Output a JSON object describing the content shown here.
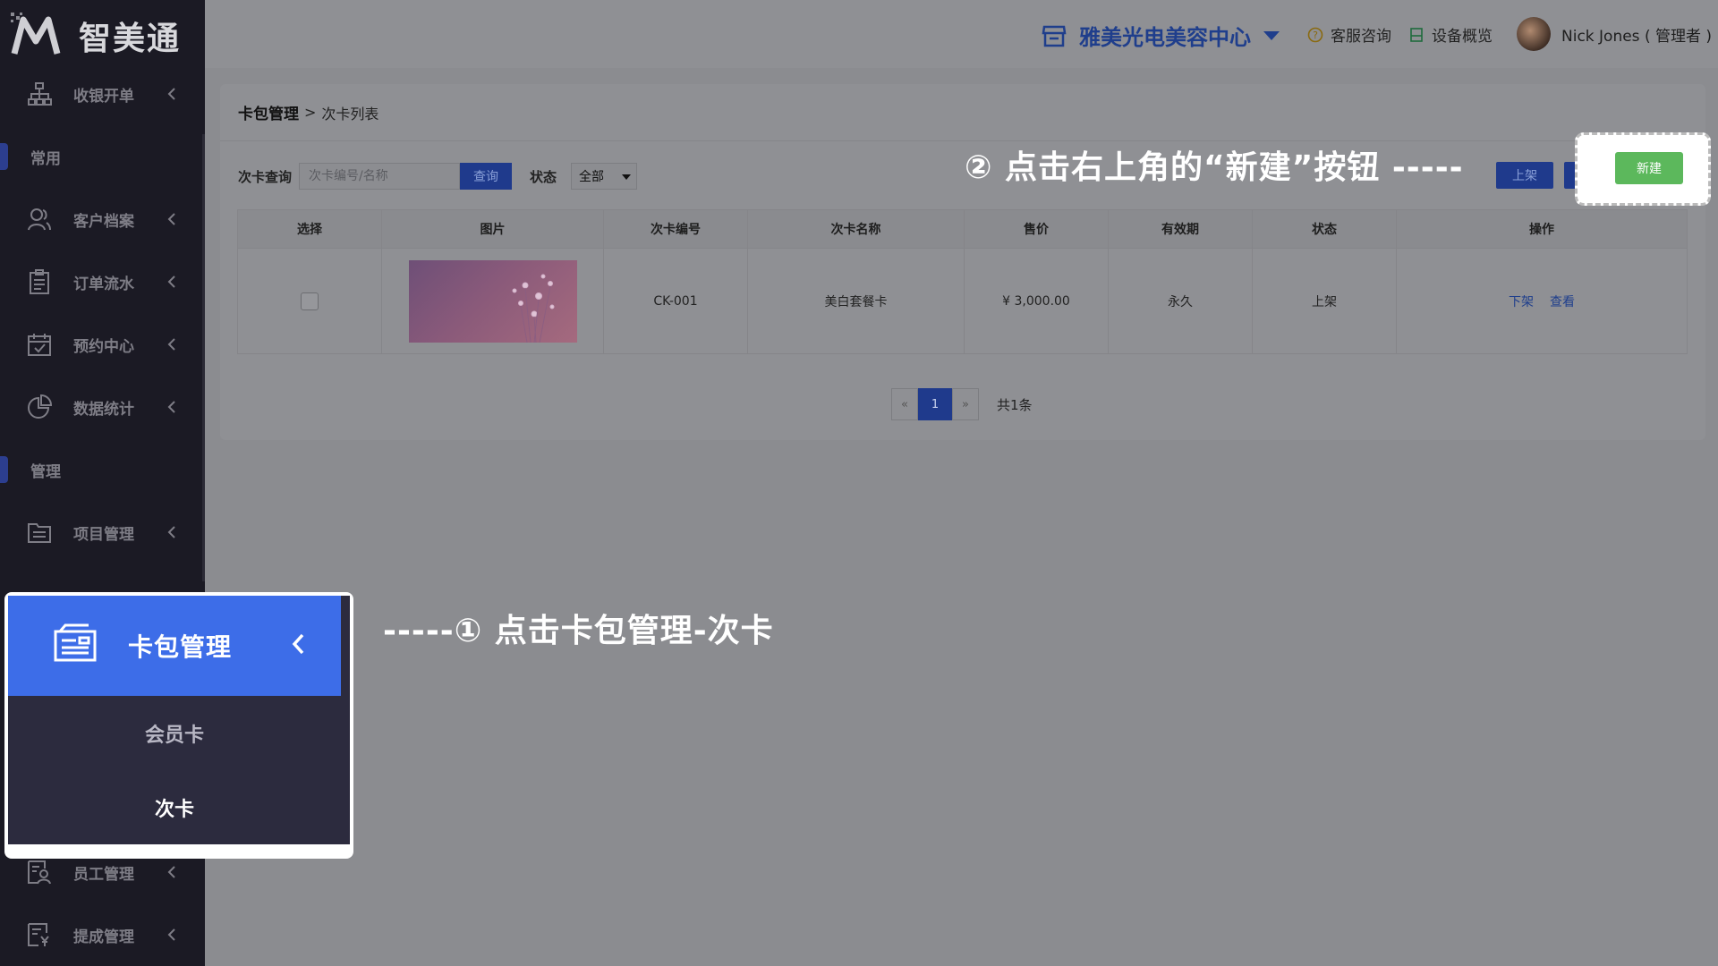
{
  "app": {
    "logo_text": "智美通"
  },
  "sidebar": {
    "items": [
      {
        "label": "收银开单",
        "icon": "org-chart-icon"
      },
      {
        "label": "客户档案",
        "icon": "customers-icon"
      },
      {
        "label": "订单流水",
        "icon": "clipboard-icon"
      },
      {
        "label": "预约中心",
        "icon": "calendar-check-icon"
      },
      {
        "label": "数据统计",
        "icon": "pie-chart-icon"
      },
      {
        "label": "项目管理",
        "icon": "list-folder-icon"
      },
      {
        "label": "员工管理",
        "icon": "staff-icon"
      },
      {
        "label": "提成管理",
        "icon": "commission-icon"
      }
    ],
    "sections": {
      "common": "常用",
      "manage": "管理"
    },
    "card_menu": {
      "label": "卡包管理",
      "sub_items": [
        {
          "label": "会员卡"
        },
        {
          "label": "次卡"
        }
      ]
    }
  },
  "header": {
    "store_name": "雅美光电美容中心",
    "service_link": "客服咨询",
    "device_link": "设备概览",
    "user": "Nick Jones ( 管理者 )"
  },
  "breadcrumb": {
    "main": "卡包管理",
    "sep": ">",
    "sub": "次卡列表"
  },
  "filter": {
    "query_label": "次卡查询",
    "query_placeholder": "次卡编号/名称",
    "query_button": "查询",
    "status_label": "状态",
    "status_value": "全部"
  },
  "actions": {
    "up_label": "上架",
    "new_label": "新建"
  },
  "table": {
    "columns": [
      "选择",
      "图片",
      "次卡编号",
      "次卡名称",
      "售价",
      "有效期",
      "状态",
      "操作"
    ],
    "rows": [
      {
        "code": "CK-001",
        "name": "美白套餐卡",
        "price": "¥ 3,000.00",
        "validity": "永久",
        "status": "上架",
        "op1": "下架",
        "op2": "查看"
      }
    ]
  },
  "pager": {
    "prev": "«",
    "page": "1",
    "next": "»",
    "total": "共1条"
  },
  "annotations": {
    "step1": "-----① 点击卡包管理-次卡",
    "step2": "② 点击右上角的“新建”按钮 -----"
  },
  "colors": {
    "accent": "#3d6de8",
    "new_button": "#5cb85c",
    "store_text": "#1f3e8c"
  }
}
